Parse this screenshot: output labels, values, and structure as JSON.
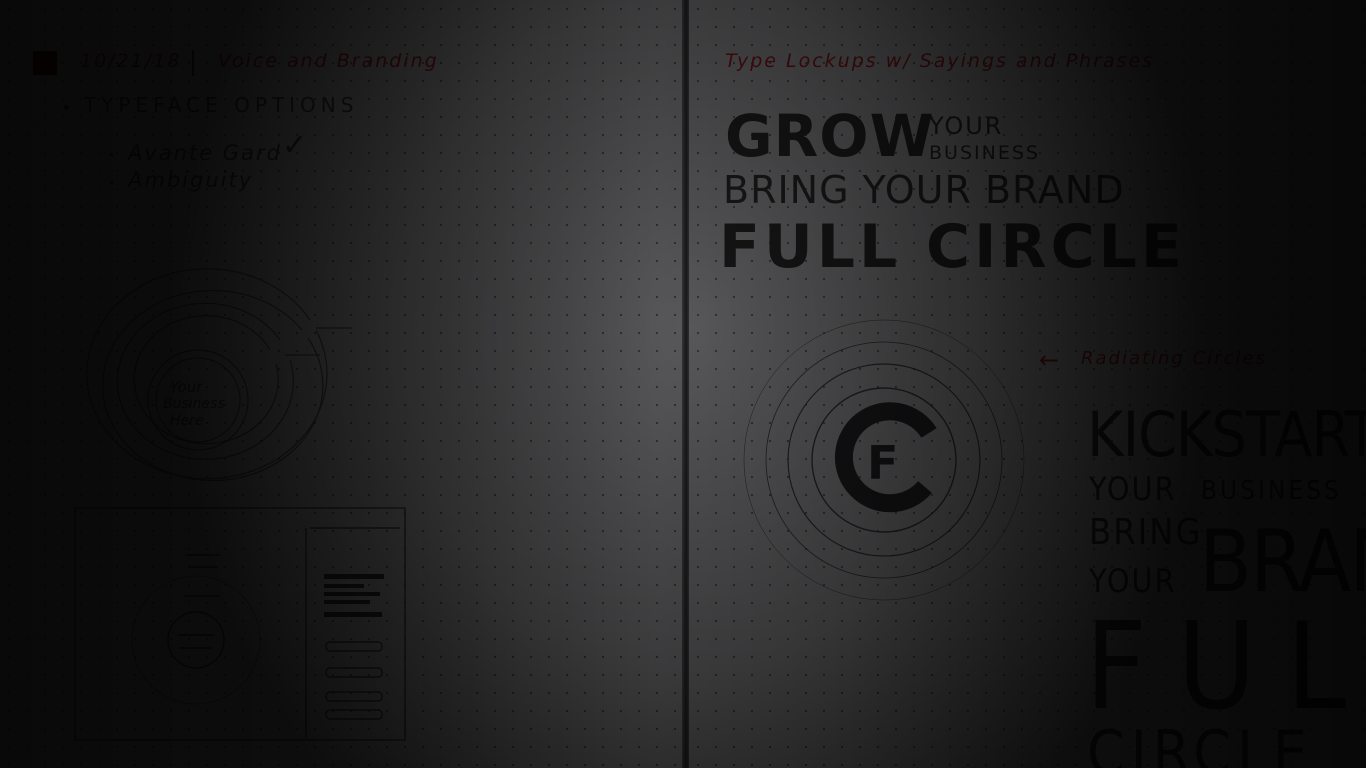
{
  "left_page": {
    "date": "10/21/18",
    "topic": "Voice and Branding",
    "section_heading": "TYPEFACE OPTIONS",
    "typeface_options": [
      "Avante Gard",
      "Ambiguity"
    ],
    "checkmark": "✓",
    "logo_text_lines": [
      "Your",
      "Business",
      "Here"
    ]
  },
  "right_page": {
    "heading": "Type Lockups w/ Sayings and Phrases",
    "lockup_1": {
      "grow": "GROW",
      "your": "YOUR",
      "business": "BUSINESS",
      "bring_your_brand": "BRING YOUR BRAND",
      "full_circle": "FULL CIRCLE"
    },
    "radiating_note": "Radiating Circles",
    "arrow": "←",
    "logo_monogram": "F",
    "lockup_2": {
      "kickstart": "KICKSTART",
      "your": "YOUR",
      "business": "BUSINESS",
      "bring": "BRING",
      "your2": "YOUR",
      "brand": "BRAND",
      "full": "FULL",
      "circle": "CIRCLE"
    }
  },
  "colors": {
    "page_paper": "#9a9a9e",
    "red_ink": "#8a1820",
    "pencil": "#2a2a2c",
    "background": "#0b0b0d"
  }
}
